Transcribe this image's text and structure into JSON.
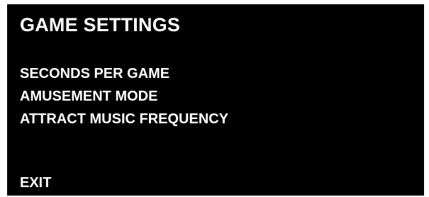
{
  "screen": {
    "title": "GAME SETTINGS",
    "menu_items": [
      {
        "label": "SECONDS PER GAME"
      },
      {
        "label": "AMUSEMENT MODE"
      },
      {
        "label": "ATTRACT MUSIC FREQUENCY"
      }
    ],
    "exit_label": "EXIT"
  },
  "colors": {
    "background": "#000000",
    "text": "#ffffff",
    "page": "#ffffff"
  }
}
